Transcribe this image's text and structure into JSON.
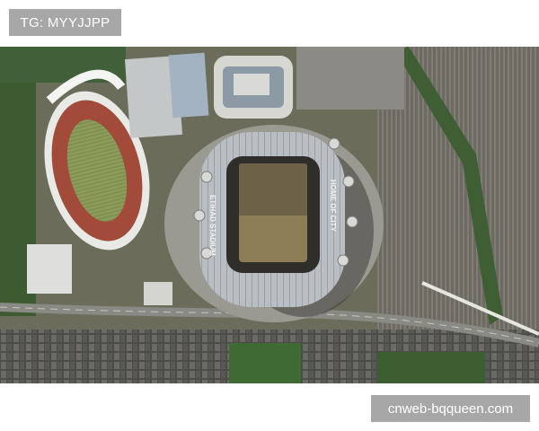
{
  "header_tag": {
    "text": "TG: MYYJJPP"
  },
  "photo": {
    "roof_text": [
      "HOME OF CITY",
      "ETIHAD STADIUM"
    ]
  },
  "watermark": {
    "text": "cnweb-bqqueen.com"
  }
}
